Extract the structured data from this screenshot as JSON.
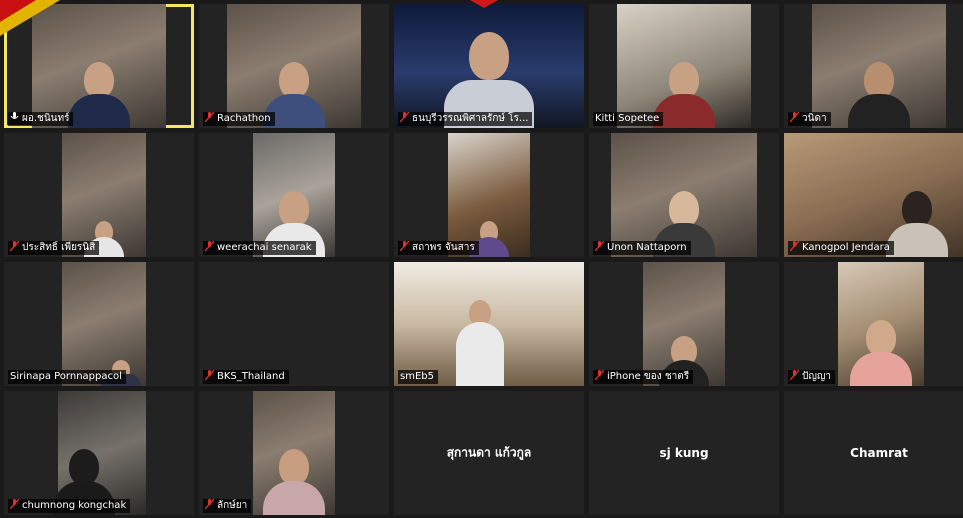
{
  "participants": [
    {
      "name": "ผอ.ชนินทร์",
      "mic": "muted",
      "speaking": true
    },
    {
      "name": "Rachathon",
      "mic": "muted"
    },
    {
      "name": "ธนบุรีวรรณพิศาลรักษ์ โร...",
      "mic": "muted"
    },
    {
      "name": "Kitti Sopetee",
      "mic": "none"
    },
    {
      "name": "วนิดา",
      "mic": "muted"
    },
    {
      "name": "ประสิทธิ์ เพียรนิสิ",
      "mic": "muted"
    },
    {
      "name": "weerachai senarak",
      "mic": "muted"
    },
    {
      "name": "สถาพร จันสาร",
      "mic": "muted"
    },
    {
      "name": "Unon Nattaporn",
      "mic": "muted"
    },
    {
      "name": "Kanogpol Jendara",
      "mic": "muted"
    },
    {
      "name": "Sirinapa Pornnappacol",
      "mic": "none"
    },
    {
      "name": "BKS_Thailand",
      "mic": "muted"
    },
    {
      "name": "smEb5",
      "mic": "none"
    },
    {
      "name": "iPhone ของ ชาตรี",
      "mic": "muted"
    },
    {
      "name": "ปัญญา",
      "mic": "muted"
    },
    {
      "name": "chumnong kongchak",
      "mic": "muted"
    },
    {
      "name": "ลักษ์ยา",
      "mic": "muted"
    },
    {
      "name": "สุกานดา แก้วกูล",
      "mic": "none"
    },
    {
      "name": "sj kung",
      "mic": "none"
    },
    {
      "name": "Chamrat",
      "mic": "none"
    }
  ],
  "colors": {
    "active_speaker": "#f5e663",
    "mic_muted": "#e03030",
    "banner_stroke": "#1c7c2c"
  }
}
